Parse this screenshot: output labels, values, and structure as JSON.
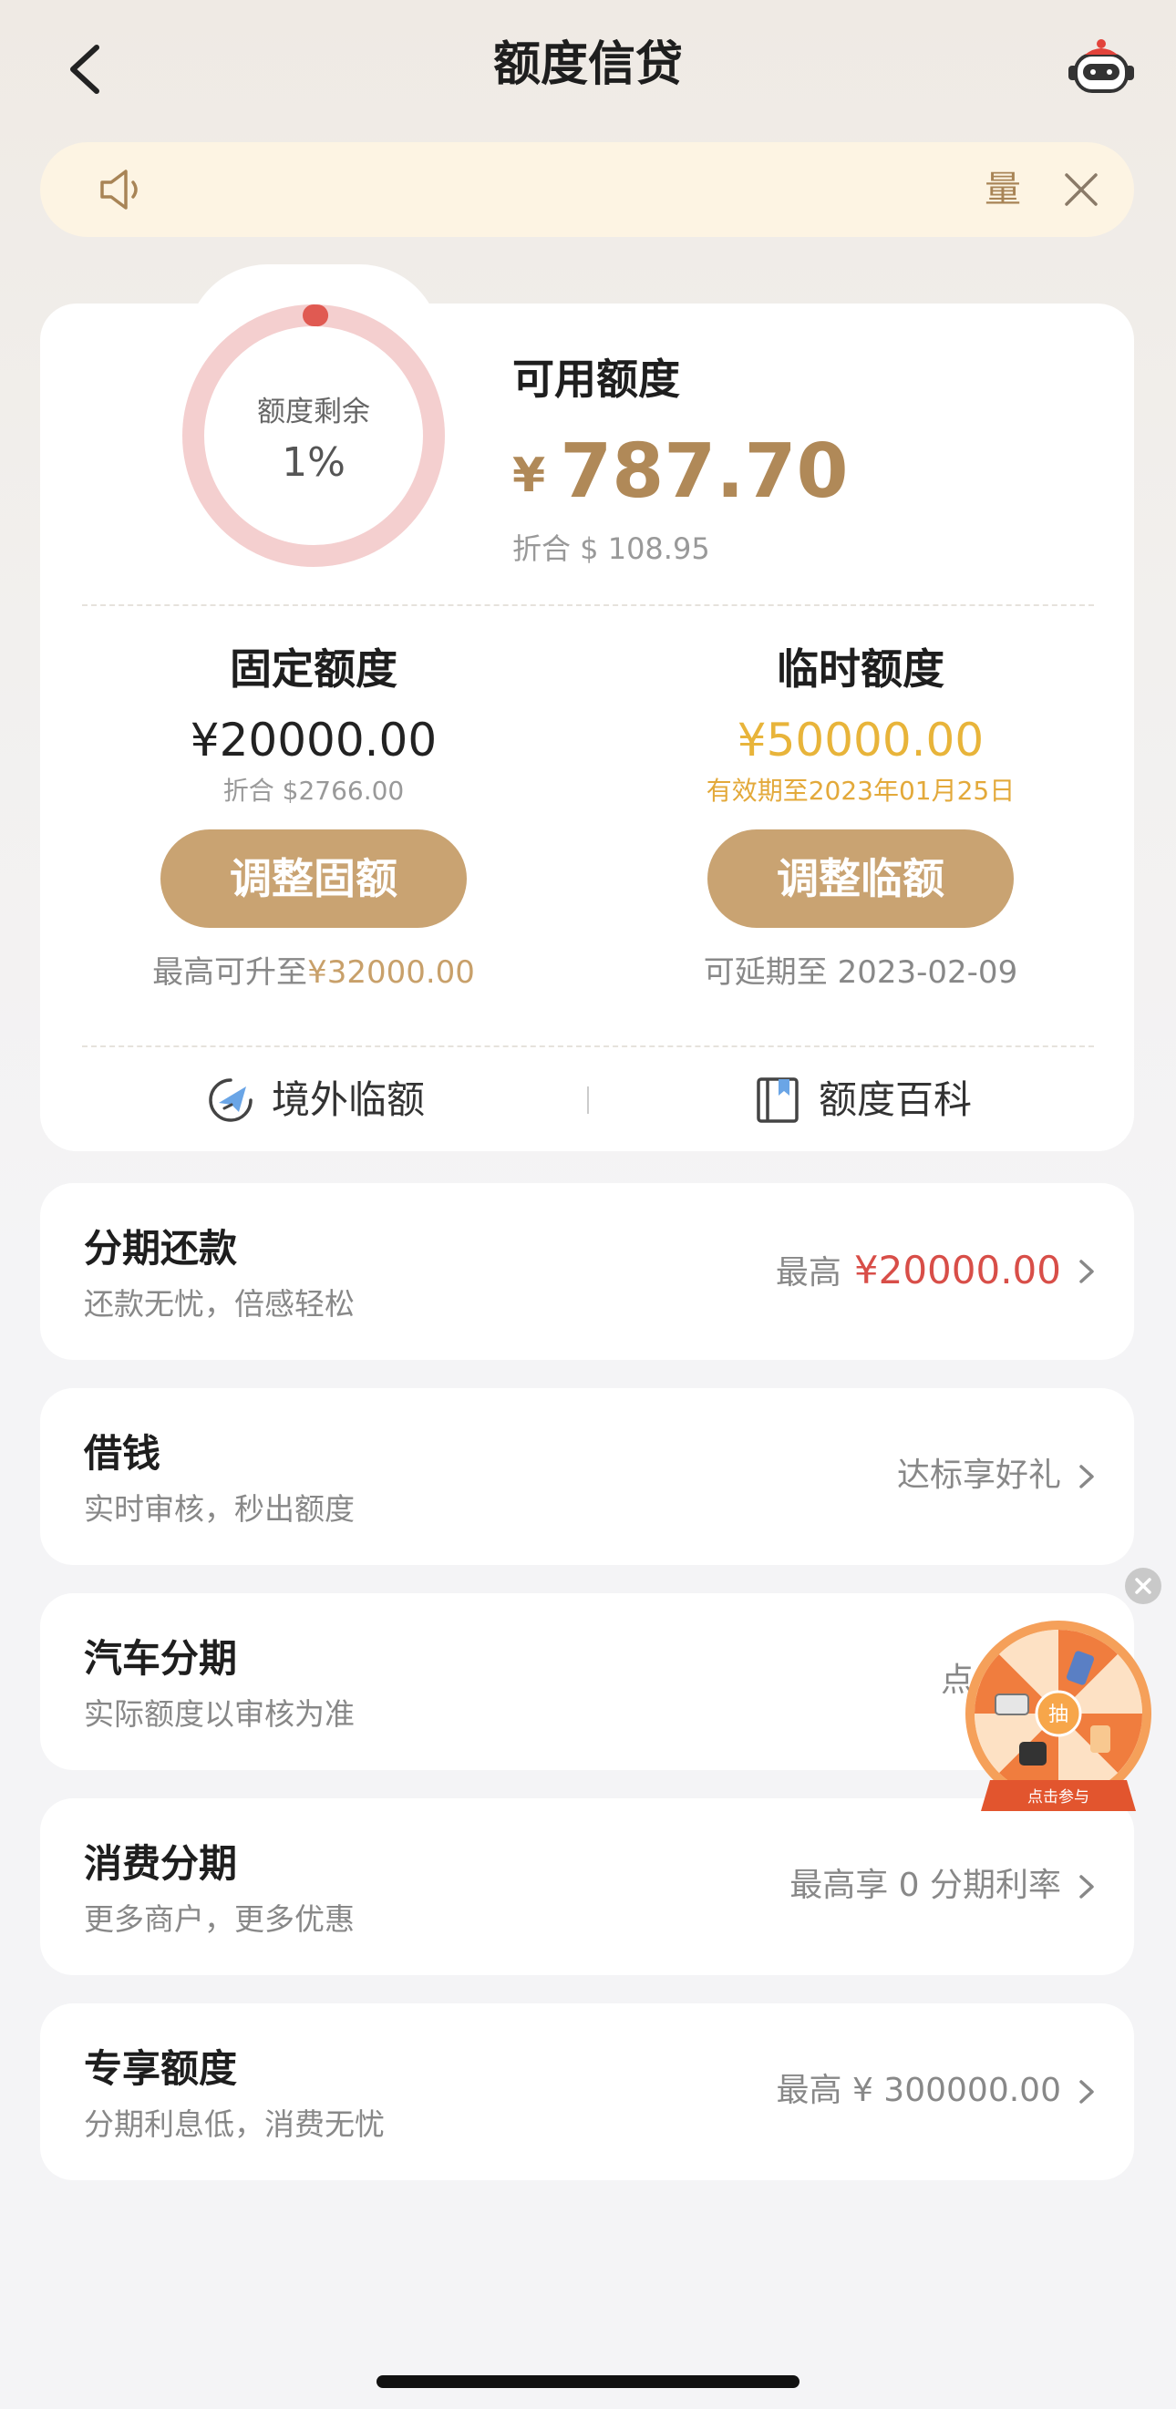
{
  "header": {
    "title": "额度信贷"
  },
  "notice": {
    "text": "量"
  },
  "credit": {
    "ring_label": "额度剩余",
    "ring_percent": "1%",
    "remaining_fraction": 0.01,
    "available_title": "可用额度",
    "available_currency": "¥",
    "available_amount": "787.70",
    "available_converted": "折合 $ 108.95",
    "fixed": {
      "title": "固定额度",
      "amount": "¥20000.00",
      "sub": "折合 $2766.00",
      "button": "调整固额",
      "note_prefix": "最高可升至",
      "note_value": "¥32000.00"
    },
    "temporary": {
      "title": "临时额度",
      "amount": "¥50000.00",
      "sub": "有效期至2023年01月25日",
      "button": "调整临额",
      "note": "可延期至 2023-02-09"
    },
    "links": {
      "overseas": "境外临额",
      "wiki": "额度百科"
    }
  },
  "rows": [
    {
      "title": "分期还款",
      "sub": "还款无忧，倍感轻松",
      "right_prefix": "最高",
      "right_value": "¥20000.00"
    },
    {
      "title": "借钱",
      "sub": "实时审核，秒出额度",
      "right_text": "达标享好礼"
    },
    {
      "title": "汽车分期",
      "sub": "实际额度以审核为准",
      "right_text": "点击"
    },
    {
      "title": "消费分期",
      "sub": "更多商户，更多优惠",
      "right_text": "最高享 0 分期利率"
    },
    {
      "title": "专享额度",
      "sub": "分期利息低，消费无忧",
      "right_text": "最高 ¥ 300000.00"
    }
  ],
  "wheel": {
    "center_label": "抽",
    "cta": "点击参与"
  },
  "colors": {
    "gold": "#b08958",
    "button_gold": "#c9a372",
    "highlight_yellow": "#e8b43a",
    "red": "#d84e48",
    "ring_track": "#f4cfcf",
    "ring_fill": "#e05a52"
  }
}
